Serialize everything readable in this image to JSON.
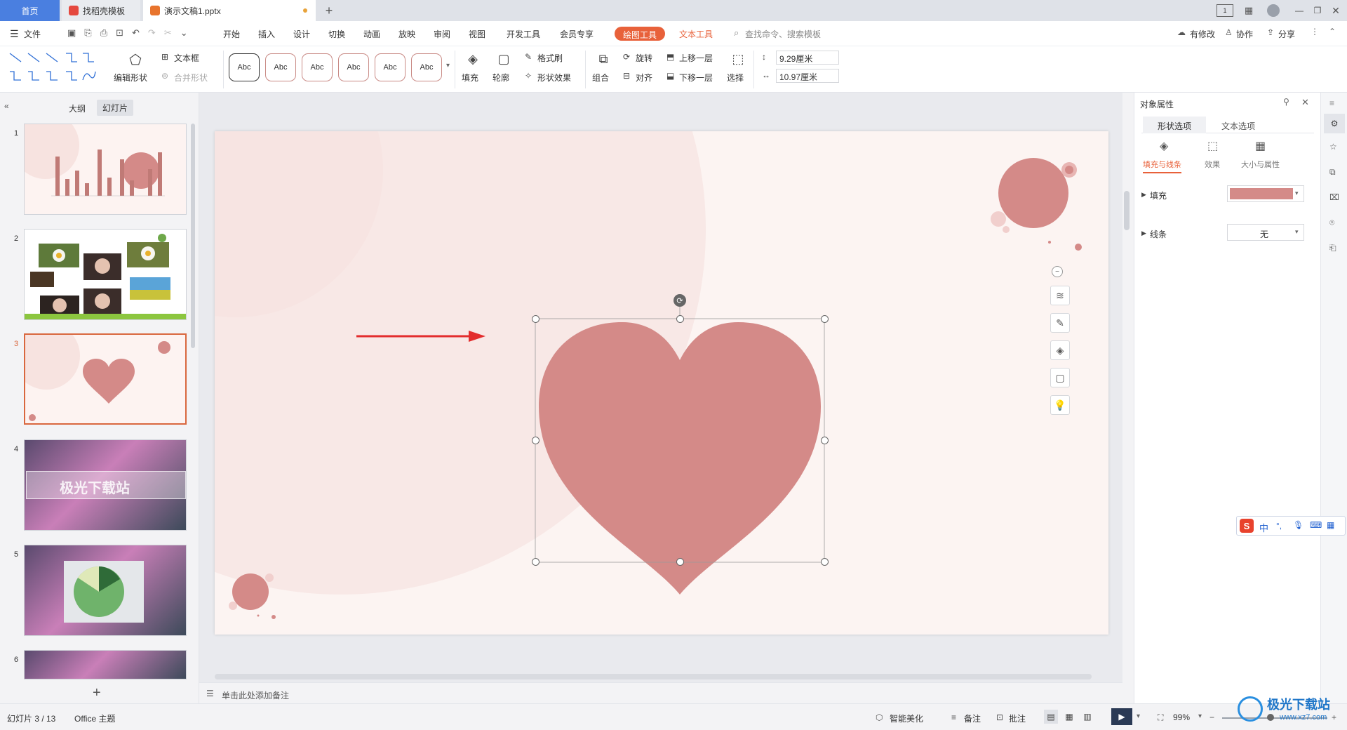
{
  "tabs": {
    "home": "首页",
    "template": "找稻壳模板",
    "document": "演示文稿1.pptx"
  },
  "menu": {
    "file": "文件",
    "items": [
      "开始",
      "插入",
      "设计",
      "切换",
      "动画",
      "放映",
      "审阅",
      "视图",
      "开发工具",
      "会员专享"
    ],
    "drawing_tools": "绘图工具",
    "text_tools": "文本工具",
    "search_placeholder": "查找命令、搜索模板",
    "modify": "有修改",
    "collaborate": "协作",
    "share": "分享"
  },
  "ribbon": {
    "edit_shape": "编辑形状",
    "text_box": "文本框",
    "merge_shape": "合并形状",
    "style_preview": "Abc",
    "fill": "填充",
    "outline": "轮廓",
    "format_painter": "格式刷",
    "shape_effect": "形状效果",
    "group": "组合",
    "rotate": "旋转",
    "align": "对齐",
    "bring_forward": "上移一层",
    "send_backward": "下移一层",
    "select": "选择",
    "height": "9.29厘米",
    "width": "10.97厘米"
  },
  "left_panel": {
    "outline_tab": "大纲",
    "slides_tab": "幻灯片",
    "slides": [
      "1",
      "2",
      "3",
      "4",
      "5",
      "6"
    ],
    "slide4_text": "极光下载站"
  },
  "notes_placeholder": "单击此处添加备注",
  "right_panel": {
    "title": "对象属性",
    "tab_shape": "形状选项",
    "tab_text": "文本选项",
    "sub_fill_line": "填充与线条",
    "sub_effect": "效果",
    "sub_size": "大小与属性",
    "fill_label": "填充",
    "line_label": "线条",
    "line_value": "无",
    "fill_color": "#d48a88"
  },
  "status": {
    "slide_counter": "幻灯片 3 / 13",
    "theme": "Office 主题",
    "smart_beautify": "智能美化",
    "notes": "备注",
    "comments": "批注",
    "zoom": "99%"
  },
  "ime": {
    "mode": "中"
  },
  "watermark": {
    "name": "极光下载站",
    "url": "www.xz7.com"
  },
  "colors": {
    "accent": "#e8613a",
    "heart": "#d48a88",
    "home_tab": "#4a7fe0"
  }
}
